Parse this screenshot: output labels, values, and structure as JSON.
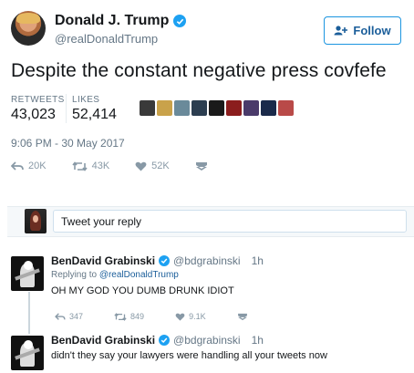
{
  "tweet": {
    "author_name": "Donald J. Trump",
    "author_handle": "@realDonaldTrump",
    "follow_label": "Follow",
    "text": "Despite the constant negative press covfefe",
    "retweets_label": "RETWEETS",
    "retweets": "43,023",
    "likes_label": "LIKES",
    "likes": "52,414",
    "timestamp": "9:06 PM - 30 May 2017",
    "actions": {
      "reply_count": "20K",
      "retweet_count": "43K",
      "like_count": "52K"
    },
    "liker_avatars": [
      "#3a3a3a",
      "#c9a24a",
      "#6a8a9a",
      "#2c3e50",
      "#1a1a1a",
      "#8b1d1d",
      "#4a3a6a",
      "#1a2a4a",
      "#b94a48"
    ]
  },
  "reply_box": {
    "placeholder": "Tweet your reply"
  },
  "replies": [
    {
      "name": "BenDavid Grabinski",
      "handle": "@bdgrabinski",
      "time": "1h",
      "replying_prefix": "Replying to",
      "replying_to": "@realDonaldTrump",
      "text": "OH MY GOD YOU DUMB DRUNK IDIOT",
      "reply_count": "347",
      "retweet_count": "849",
      "like_count": "9.1K"
    },
    {
      "name": "BenDavid Grabinski",
      "handle": "@bdgrabinski",
      "time": "1h",
      "text": "didn't they say your lawyers were handling all your tweets now"
    }
  ],
  "colors": {
    "accent": "#1da1f2",
    "muted": "#657786",
    "link": "#1b5e9a"
  }
}
